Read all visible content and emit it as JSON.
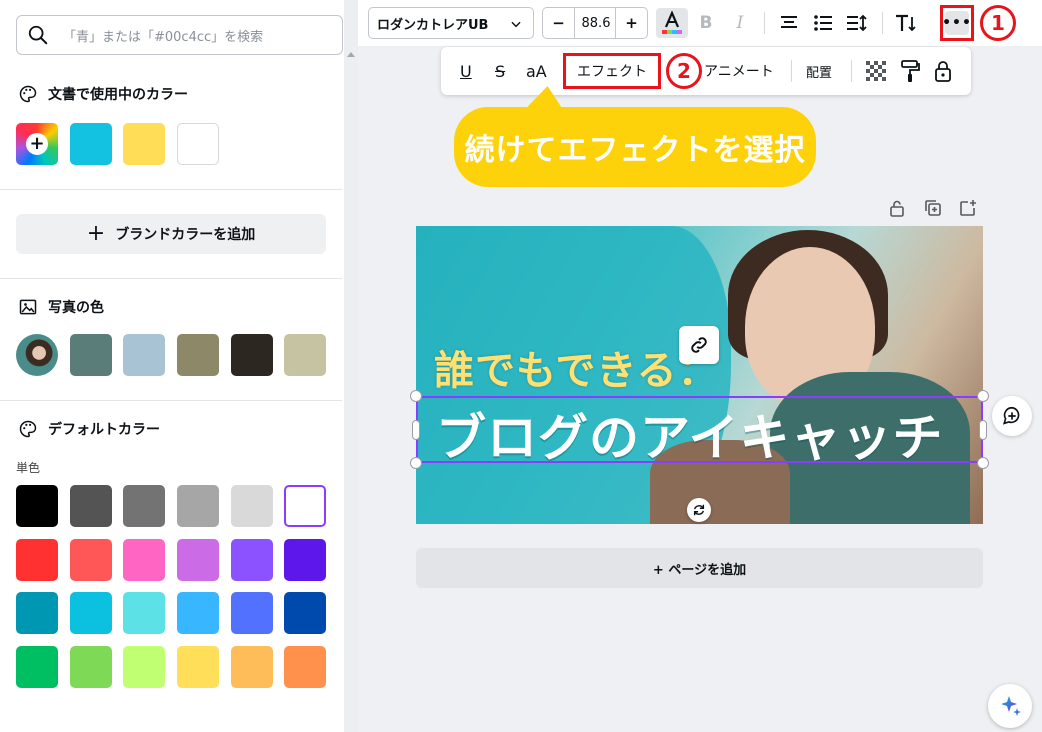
{
  "search": {
    "placeholder": "「青」または「#00c4cc」を検索"
  },
  "sections": {
    "document_colors": "文書で使用中のカラー",
    "brand_button": "ブランドカラーを追加",
    "photo_colors": "写真の色",
    "default_colors": "デフォルトカラー",
    "solid_label": "単色"
  },
  "colors": {
    "document": [
      "#12c2e0",
      "#ffdd57",
      "#ffffff"
    ],
    "photo": [
      "#5b7d79",
      "#a8c3d3",
      "#8d8968",
      "#2d2722",
      "#c6c3a2"
    ],
    "default": [
      [
        "#000000",
        "#545454",
        "#737373",
        "#a6a6a6",
        "#d9d9d9",
        "#ffffff"
      ],
      [
        "#ff3131",
        "#ff5757",
        "#ff66c4",
        "#cb6ce6",
        "#8c52ff",
        "#5e17eb"
      ],
      [
        "#0097b2",
        "#0cc0df",
        "#5ce1e6",
        "#38b6ff",
        "#5271ff",
        "#004aad"
      ],
      [
        "#00bf63",
        "#7ed957",
        "#c1ff72",
        "#ffde59",
        "#ffbd59",
        "#ff914d"
      ]
    ],
    "accent_red": "#e8131b",
    "selection": "#8b3dff",
    "callout_yellow": "#fdd20a"
  },
  "toolbar": {
    "font_name": "ロダンカトレアUB",
    "font_size": "88.6",
    "minus": "−",
    "plus": "+",
    "bold": "B",
    "italic": "I",
    "more": "•••",
    "badge1": "1",
    "badge2": "2"
  },
  "sub_toolbar": {
    "underline": "U",
    "strike": "S",
    "case": "aA",
    "effect": "エフェクト",
    "animate": "アニメート",
    "position": "配置"
  },
  "callout": {
    "text": "続けてエフェクトを選択"
  },
  "design": {
    "headline1": "誰でもできる：",
    "headline2": "ブログのアイキャッチ"
  },
  "add_page": {
    "label": "+ ページを追加"
  }
}
